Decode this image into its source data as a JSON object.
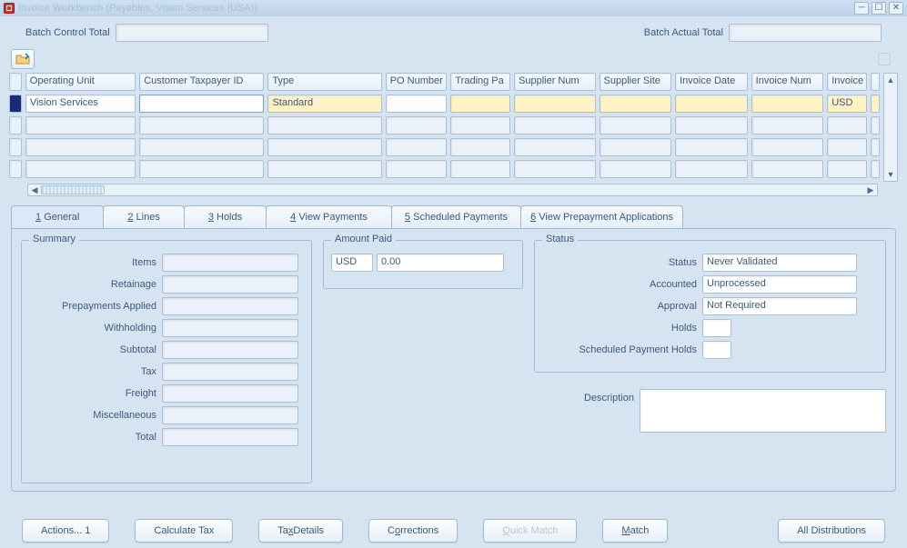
{
  "window": {
    "title": "Invoice Workbench (Payables, Vision Services (USA))"
  },
  "batch": {
    "control_label": "Batch Control Total",
    "actual_label": "Batch Actual Total",
    "control_value": "",
    "actual_value": ""
  },
  "grid": {
    "headers": {
      "op": "Operating Unit",
      "tax": "Customer Taxpayer ID",
      "type": "Type",
      "po": "PO Number",
      "tp": "Trading Pa",
      "sn": "Supplier Num",
      "ss": "Supplier Site",
      "idt": "Invoice Date",
      "inm": "Invoice Num",
      "cur": "Invoice"
    },
    "row1": {
      "op": "Vision Services",
      "tax": "",
      "type": "Standard",
      "po": "",
      "tp": "",
      "sn": "",
      "ss": "",
      "idt": "",
      "inm": "",
      "cur": "USD"
    }
  },
  "tabs": {
    "general": "General",
    "lines": "Lines",
    "holds": "Holds",
    "view_payments": "View Payments",
    "sched": "Scheduled Payments",
    "prepay": "View Prepayment Applications",
    "n": {
      "t1": "1",
      "t2": "2",
      "t3": "3",
      "t4": "4",
      "t5": "5",
      "t6": "6"
    }
  },
  "summary": {
    "legend": "Summary",
    "labels": {
      "items": "Items",
      "retainage": "Retainage",
      "prepay": "Prepayments Applied",
      "with": "Withholding",
      "subtotal": "Subtotal",
      "tax": "Tax",
      "freight": "Freight",
      "misc": "Miscellaneous",
      "total": "Total"
    },
    "values": {
      "items": "",
      "retainage": "",
      "prepay": "",
      "with": "",
      "subtotal": "",
      "tax": "",
      "freight": "",
      "misc": "",
      "total": ""
    }
  },
  "amount_paid": {
    "legend": "Amount Paid",
    "currency": "USD",
    "value": "0.00"
  },
  "status": {
    "legend": "Status",
    "labels": {
      "status": "Status",
      "accounted": "Accounted",
      "approval": "Approval",
      "holds": "Holds",
      "sph": "Scheduled Payment Holds"
    },
    "values": {
      "status": "Never Validated",
      "accounted": "Unprocessed",
      "approval": "Not Required",
      "holds": "",
      "sph": ""
    },
    "desc_label": "Description",
    "desc_value": ""
  },
  "buttons": {
    "actions": "Actions... 1",
    "calc": "Calculate Tax",
    "taxd_pre": "Ta",
    "taxd_u": "x",
    "taxd_post": " Details",
    "corr_pre": "C",
    "corr_u": "o",
    "corr_post": "rrections",
    "qm_u": "Q",
    "qm_post": "uick Match",
    "match_u": "M",
    "match_post": "atch",
    "alldist": "All Distributions"
  }
}
